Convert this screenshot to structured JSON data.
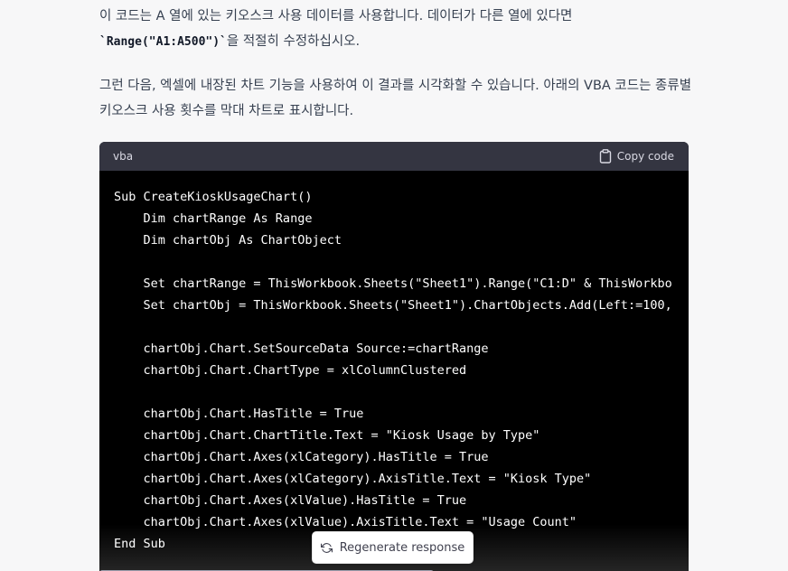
{
  "message": {
    "para1_text_a": "이 코드는 A 열에 있는 키오스크 사용 데이터를 사용합니다. 데이터가 다른 열에 있다면",
    "para1_code": "`Range(\"A1:A500\")`",
    "para1_text_b": "을 적절히 수정하십시오.",
    "para2_text": "그런 다음, 엑셀에 내장된 차트 기능을 사용하여 이 결과를 시각화할 수 있습니다. 아래의 VBA 코드는 종류별 키오스크 사용 횟수를 막대 차트로 표시합니다."
  },
  "code_block": {
    "language": "vba",
    "copy_label": "Copy code",
    "lines": [
      "Sub CreateKioskUsageChart()",
      "    Dim chartRange As Range",
      "    Dim chartObj As ChartObject",
      "",
      "    Set chartRange = ThisWorkbook.Sheets(\"Sheet1\").Range(\"C1:D\" & ThisWorkbo",
      "    Set chartObj = ThisWorkbook.Sheets(\"Sheet1\").ChartObjects.Add(Left:=100,",
      "",
      "    chartObj.Chart.SetSourceData Source:=chartRange",
      "    chartObj.Chart.ChartType = xlColumnClustered",
      "",
      "    chartObj.Chart.HasTitle = True",
      "    chartObj.Chart.ChartTitle.Text = \"Kiosk Usage by Type\"",
      "    chartObj.Chart.Axes(xlCategory).HasTitle = True",
      "    chartObj.Chart.Axes(xlCategory).AxisTitle.Text = \"Kiosk Type\"",
      "    chartObj.Chart.Axes(xlValue).HasTitle = True",
      "    chartObj.Chart.Axes(xlValue).AxisTitle.Text = \"Usage Count\"",
      "End Sub"
    ]
  },
  "regenerate": {
    "label": "Regenerate response",
    "icon": "refresh-icon"
  },
  "colors": {
    "page_bg": "#f7f7f8",
    "text": "#374151",
    "code_bg": "#000000",
    "code_header_bg": "#343541"
  }
}
